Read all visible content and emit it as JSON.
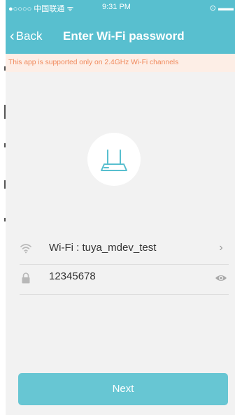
{
  "statusbar": {
    "carrier": "●○○○○ 中国联通 ᯤ",
    "time": "9:31 PM",
    "icons": "⊙ ▬▬"
  },
  "navbar": {
    "back_label": "Back",
    "title": "Enter Wi-Fi password"
  },
  "notice": {
    "text": "This app is supported only on 2.4GHz Wi-Fi channels"
  },
  "wifi": {
    "label": "Wi-Fi : tuya_mdev_test",
    "icon": "wifi-icon",
    "chevron": "›"
  },
  "password": {
    "value": "12345678",
    "icon": "lock-icon",
    "toggle_icon": "eye-icon"
  },
  "next_button": {
    "label": "Next"
  },
  "colors": {
    "header": "#58bfcf",
    "notice_bg": "#fdeee6",
    "notice_text": "#f08a5d",
    "button": "#67c6d3",
    "background": "#f2f2f2"
  }
}
